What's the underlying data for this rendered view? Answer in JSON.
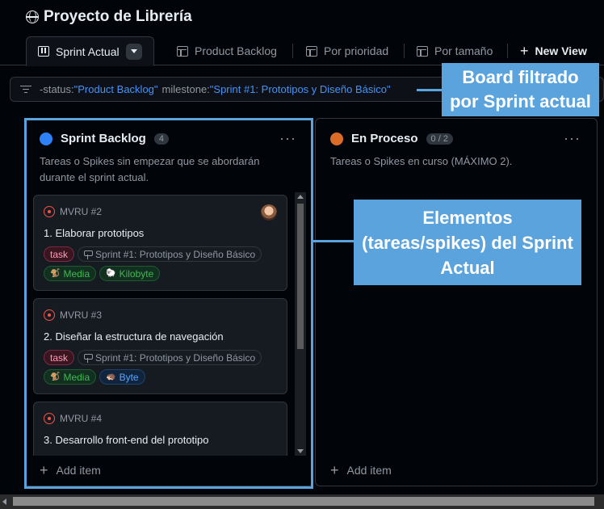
{
  "project": {
    "title": "Proyecto de Librería"
  },
  "tabs": [
    {
      "label": "Sprint Actual",
      "active": true
    },
    {
      "label": "Product Backlog"
    },
    {
      "label": "Por prioridad"
    },
    {
      "label": "Por tamaño"
    }
  ],
  "new_view_label": "New View",
  "filter": {
    "k1": "-status:",
    "v1": "\"Product Backlog\"",
    "k2": "milestone:",
    "v2": "\"Sprint #1: Prototipos y Diseño Básico\""
  },
  "columns": [
    {
      "title": "Sprint Backlog",
      "count": "4",
      "color": "#2f81f7",
      "description_line1": "Tareas o Spikes sin empezar que se abordarán",
      "description_line2": "durante el sprint actual.",
      "add_item": "Add item",
      "cards": [
        {
          "id": "MVRU #2",
          "title": "1. Elaborar prototipos",
          "type_label": "task",
          "milestone": "Sprint #1: Prototipos y Diseño Básico",
          "priority": "Media",
          "size": "Kilobyte"
        },
        {
          "id": "MVRU #3",
          "title": "2. Diseñar la estructura de navegación",
          "type_label": "task",
          "milestone": "Sprint #1: Prototipos y Diseño Básico",
          "priority": "Media",
          "size": "Byte"
        },
        {
          "id": "MVRU #4",
          "title": "3. Desarrollo front-end del prototipo"
        }
      ]
    },
    {
      "title": "En Proceso",
      "count": "0 / 2",
      "color": "#db6d28",
      "description": "Tareas o Spikes en curso (MÁXIMO 2).",
      "add_item": "Add item"
    }
  ],
  "annotations": {
    "filter_line1": "Board filtrado",
    "filter_line2": "por Sprint actual",
    "items_line1": "Elementos",
    "items_line2": "(tareas/spikes) del Sprint",
    "items_line3": "Actual"
  },
  "colors": {
    "annotation": "#5ba3dc",
    "accent_link": "#4493f8",
    "background": "#010409"
  }
}
